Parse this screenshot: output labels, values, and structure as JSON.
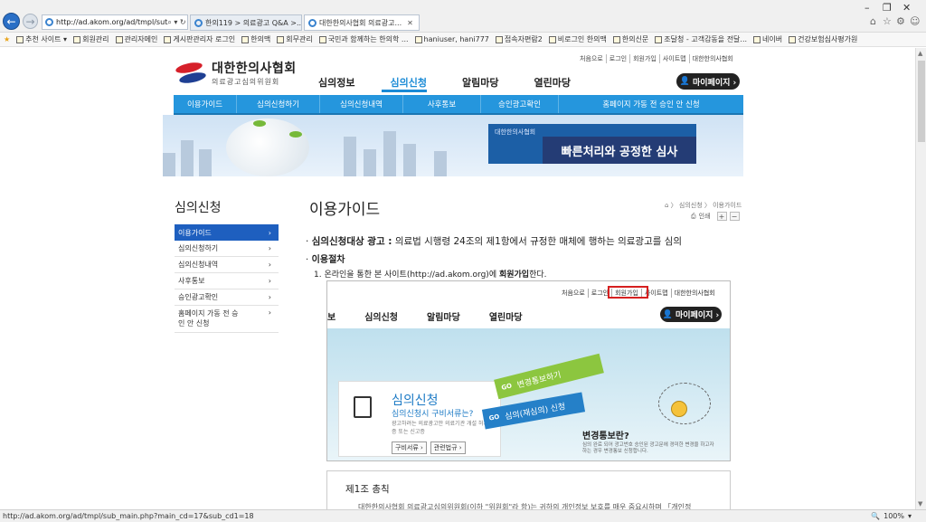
{
  "browser": {
    "url": "http://ad.akom.org/ad/tmpl/sut",
    "tabs": [
      {
        "title": "한의119 > 의료광고 Q&A >..."
      },
      {
        "title": "대한한의사협회 의료광고..."
      }
    ],
    "favorites": [
      "추천 사이트 ▾",
      "회원관리",
      "관리자메인",
      "게시판관리자 로그인",
      "한의맥",
      "회무관리",
      "국민과 함께하는 한의학 ...",
      "haniuser, hani777",
      "접속자편람2",
      "비로그인 한의맥",
      "한의신문",
      "조달청 - 고객감동을 전달...",
      "네이버",
      "건강보험심사평가원"
    ],
    "status_url": "http://ad.akom.org/ad/tmpl/sub_main.php?main_cd=17&sub_cd1=18",
    "zoom": "100%"
  },
  "site": {
    "logo_title": "대한한의사협회",
    "logo_sub": "의료광고심의위원회",
    "toplinks": [
      "처음으로",
      "로그인",
      "회원가입",
      "사이트맵",
      "대한한의사협회"
    ],
    "gnb": [
      "심의정보",
      "심의신청",
      "알림마당",
      "열린마당"
    ],
    "mypage": "마이페이지 ›",
    "subnav": [
      "이용가이드",
      "심의신청하기",
      "심의신청내역",
      "사후통보",
      "승인광고확인",
      "홈페이지 가동 전 승인 안 신청"
    ],
    "banner_small": "대한한의사협회",
    "banner_main": "빠른처리와 공정한 심사"
  },
  "lnb": {
    "title": "심의신청",
    "items": [
      "이용가이드",
      "심의신청하기",
      "심의신청내역",
      "사후통보",
      "승인광고확인",
      "홈페이지 가동 전 승인 안 신청"
    ]
  },
  "content": {
    "title": "이용가이드",
    "breadcrumb": "⌂ 〉 심의신청 〉 이용가이드",
    "print": "인쇄",
    "line1_bold": "심의신청대상 광고 :",
    "line1_rest": " 의료법 시행령 24조의 제1항에서 규정한 매체에 행하는 의료광고를 심의",
    "line2": "이용절차",
    "line3_a": "1. 온라인을 통한 본 사이트(http://ad.akom.org)에 ",
    "line3_b": "회원가입",
    "line3_c": "한다.",
    "shot": {
      "toplinks": [
        "처음으로",
        "로그인",
        "회원가입",
        "사이트맵",
        "대한한의사협회"
      ],
      "gnb": [
        "보",
        "심의신청",
        "알림마당",
        "열린마당"
      ],
      "mypage": "마이페이지 ›",
      "card_title": "심의신청",
      "card_sub": "심의신청시 구비서류는?",
      "card_desc": "광고하려는 의료광고안 의료기관 개설 허가증 또는 신고증",
      "btn1": "구비서류 ›",
      "btn2": "관련법규 ›",
      "go1": "변경통보하기",
      "go2": "심의(재심의) 신청",
      "go": "GO",
      "right_title": "변경통보란?",
      "right_desc": "심의 완료 되어 광고번호 승인된 광고문에 경미한 변경을 하고자 하는 경우 변경통보 신청합니다."
    },
    "article_title": "제1조 총칙",
    "article_text": "대한한의사협회 의료광고심의위원회(이하 \"위원회\"라 함)는 귀하의 개인정보 보호를 매우 중요시하며 「개인정"
  }
}
